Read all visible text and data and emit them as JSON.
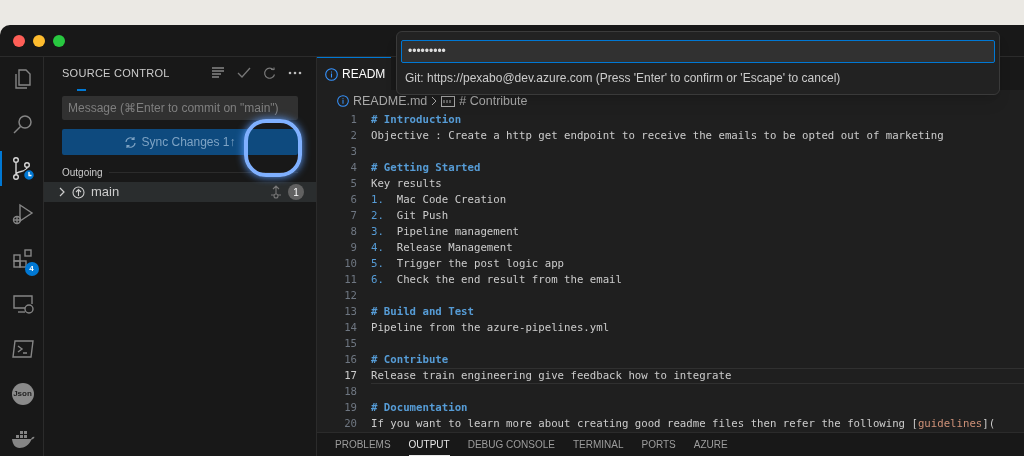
{
  "activity_bar": [
    {
      "kind": "files",
      "selected": false
    },
    {
      "kind": "search",
      "selected": false
    },
    {
      "kind": "scm",
      "selected": true
    },
    {
      "kind": "debug",
      "selected": false
    },
    {
      "kind": "extensions",
      "selected": false,
      "badge": "4"
    },
    {
      "kind": "remote",
      "selected": false
    },
    {
      "kind": "terminal",
      "selected": false
    },
    {
      "kind": "json",
      "selected": false,
      "label": "Json"
    },
    {
      "kind": "docker",
      "selected": false
    }
  ],
  "sidebar": {
    "title": "SOURCE CONTROL",
    "message": {
      "placeholder": "Message (⌘Enter to commit on \"main\")"
    },
    "sync_button": "Sync Changes 1↑",
    "section": "Outgoing",
    "branch": {
      "name": "main",
      "count": "1",
      "expanded": false
    }
  },
  "editor": {
    "tab": "READM",
    "breadcrumb": [
      "README.md",
      "# Contribute"
    ],
    "lines": [
      {
        "number": "1",
        "current": false,
        "segments": [
          {
            "kind": "heading",
            "text": "# Introduction"
          }
        ]
      },
      {
        "number": "2",
        "current": false,
        "segments": [
          {
            "kind": "plain",
            "text": "Objective : Create a http get endpoint to receive the emails to be opted out of marketing"
          }
        ]
      },
      {
        "number": "3",
        "current": false
      },
      {
        "number": "4",
        "current": false,
        "segments": [
          {
            "kind": "heading",
            "text": "# Getting Started"
          }
        ]
      },
      {
        "number": "5",
        "current": false,
        "segments": [
          {
            "kind": "plain",
            "text": "Key results"
          }
        ]
      },
      {
        "number": "6",
        "current": false,
        "segments": [
          {
            "kind": "list",
            "text": "1."
          },
          {
            "kind": "plain",
            "text": "  Mac Code Creation"
          }
        ]
      },
      {
        "number": "7",
        "current": false,
        "segments": [
          {
            "kind": "list",
            "text": "2."
          },
          {
            "kind": "plain",
            "text": "  Git Push"
          }
        ]
      },
      {
        "number": "8",
        "current": false,
        "segments": [
          {
            "kind": "list",
            "text": "3."
          },
          {
            "kind": "plain",
            "text": "  Pipeline management"
          }
        ]
      },
      {
        "number": "9",
        "current": false,
        "segments": [
          {
            "kind": "list",
            "text": "4."
          },
          {
            "kind": "plain",
            "text": "  Release Management"
          }
        ]
      },
      {
        "number": "10",
        "current": false,
        "segments": [
          {
            "kind": "list",
            "text": "5."
          },
          {
            "kind": "plain",
            "text": "  Trigger the post logic app"
          }
        ]
      },
      {
        "number": "11",
        "current": false,
        "segments": [
          {
            "kind": "list",
            "text": "6."
          },
          {
            "kind": "plain",
            "text": "  Check the end result from the email"
          }
        ]
      },
      {
        "number": "12",
        "current": false
      },
      {
        "number": "13",
        "current": false,
        "segments": [
          {
            "kind": "heading",
            "text": "# Build and Test"
          }
        ]
      },
      {
        "number": "14",
        "current": false,
        "segments": [
          {
            "kind": "plain",
            "text": "Pipeline from the azure-pipelines.yml"
          }
        ]
      },
      {
        "number": "15",
        "current": false
      },
      {
        "number": "16",
        "current": false,
        "segments": [
          {
            "kind": "heading",
            "text": "# Contribute"
          }
        ]
      },
      {
        "number": "17",
        "current": true,
        "segments": [
          {
            "kind": "plain",
            "text": "Release train engineering give feedback how to integrate"
          }
        ]
      },
      {
        "number": "18",
        "current": false
      },
      {
        "number": "19",
        "current": false,
        "segments": [
          {
            "kind": "heading",
            "text": "# Documentation"
          }
        ]
      },
      {
        "number": "20",
        "current": false,
        "segments": [
          {
            "kind": "plain",
            "text": "If you want to learn more about creating good readme files then refer the following ["
          },
          {
            "kind": "link",
            "text": "guidelines"
          },
          {
            "kind": "plain",
            "text": "]("
          }
        ]
      }
    ]
  },
  "panel_tabs": [
    {
      "label": "PROBLEMS",
      "selected": false
    },
    {
      "label": "OUTPUT",
      "selected": true
    },
    {
      "label": "DEBUG CONSOLE",
      "selected": false
    },
    {
      "label": "TERMINAL",
      "selected": false
    },
    {
      "label": "PORTS",
      "selected": false
    },
    {
      "label": "AZURE",
      "selected": false
    }
  ],
  "quick_input": {
    "value": "•••••••••",
    "message": "Git: https://pexabo@dev.azure.com (Press 'Enter' to confirm or 'Escape' to cancel)"
  }
}
